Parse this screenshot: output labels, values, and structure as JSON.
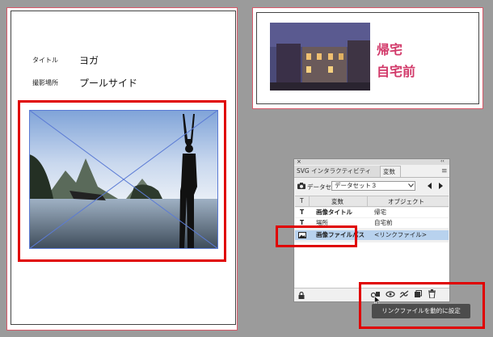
{
  "left_page": {
    "title_label": "タイトル",
    "title_value": "ヨガ",
    "location_label": "撮影場所",
    "location_value": "プールサイド"
  },
  "card": {
    "line1": "帰宅",
    "line2": "自宅前"
  },
  "panel": {
    "close_glyph": "×",
    "collapse_glyph": "‹‹",
    "tab_svg": "SVG インタラクティビティ",
    "tab_variables": "変数",
    "menu_glyph": "≡",
    "dataset_label": "データセット：",
    "dataset_value": "データセット３",
    "header_type": "T",
    "header_variable": "変数",
    "header_object": "オブジェクト",
    "rows": [
      {
        "type": "T",
        "name": "画像タイトル",
        "object": "帰宅"
      },
      {
        "type": "T",
        "name": "場所",
        "object": "自宅前"
      },
      {
        "type": "img",
        "name": "画像ファイルパス",
        "object": "<リンクファイル>"
      }
    ],
    "tooltip": "リンクファイルを動的に設定"
  },
  "colors": {
    "highlight_red": "#e00000",
    "card_text": "#d23a6a",
    "canvas": "#9b9b9b"
  },
  "icons": [
    "camera-icon",
    "prev-icon",
    "next-icon",
    "lock-icon",
    "link-dynamic-icon",
    "visibility-dynamic-icon",
    "unbind-icon",
    "new-variable-icon",
    "trash-icon"
  ]
}
